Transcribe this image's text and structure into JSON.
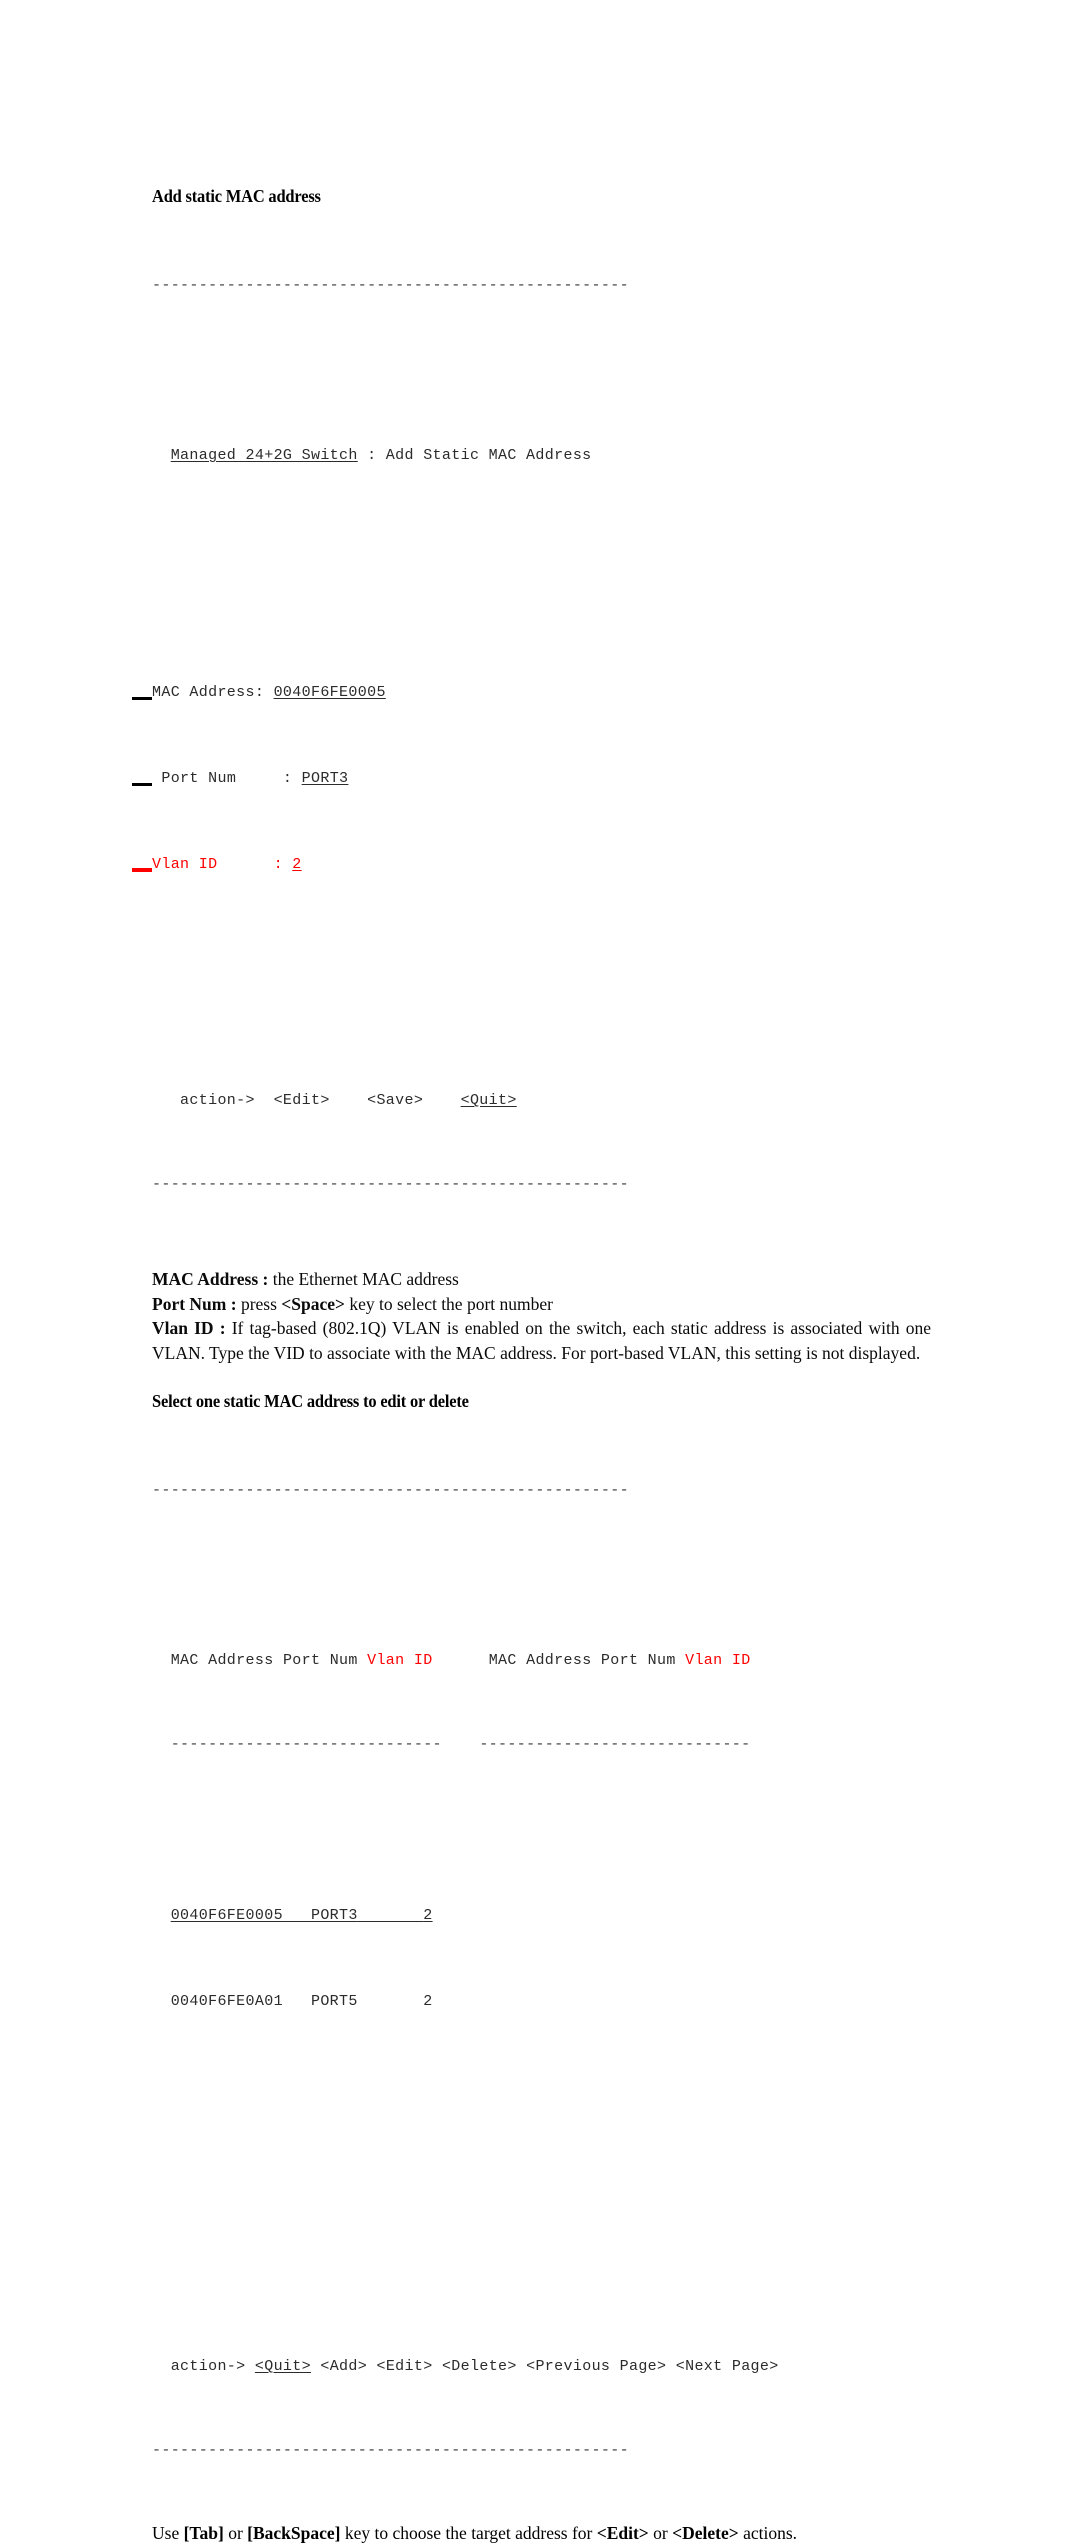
{
  "document": {
    "sections": [
      {
        "heading": "Add static MAC address",
        "terminal": {
          "top_rule": "---------------------------------------------------",
          "bottom_rule": "---------------------------------------------------",
          "title_prefix": "  ",
          "title_highlight": "Managed 24+2G Switch",
          "title_rest": " : Add Static MAC Address",
          "fields": [
            {
              "label": "MAC Address:",
              "pad": " ",
              "value": "0040F6FE0005",
              "marker": "black",
              "indent": ""
            },
            {
              "label": "Port Num",
              "pad": "     : ",
              "value": "PORT3",
              "marker": "black",
              "indent": " "
            },
            {
              "label": "Vlan ID",
              "pad": "      : ",
              "value": "2",
              "marker": "red",
              "indent": ""
            }
          ],
          "action_prefix": "   action->  ",
          "actions": [
            {
              "label": "<Edit>",
              "selected": false
            },
            {
              "label": "<Save>",
              "selected": false
            },
            {
              "label": "<Quit>",
              "selected": true
            }
          ],
          "action_gap": "  "
        }
      }
    ],
    "descriptions": [
      {
        "term": "MAC Address :",
        "text": " the Ethernet MAC address"
      },
      {
        "term": "Port Num :",
        "text": " press ",
        "kbd": "<Space>",
        "text2": " key to select the port number"
      },
      {
        "term": "Vlan ID :",
        "text": " If tag-based (802.1Q) VLAN is enabled on the switch, each static address is associated with one VLAN. Type the VID to associate with the MAC address. For port-based VLAN, this setting is not displayed."
      }
    ],
    "section2": {
      "heading": "Select one static MAC address to edit or delete",
      "terminal": {
        "top_rule": "---------------------------------------------------",
        "bottom_rule": "---------------------------------------------------",
        "header_indent": "  ",
        "columns": [
          "MAC Address",
          "Port Num",
          "Vlan ID"
        ],
        "column_gap": "      ",
        "col_rule": "-----------------------------",
        "col_rule_gap": "    ",
        "rows": [
          {
            "mac": "0040F6FE0005",
            "port": "PORT3",
            "vlan": "2",
            "selected": true
          },
          {
            "mac": "0040F6FE0A01",
            "port": "PORT5",
            "vlan": "2",
            "selected": false
          }
        ],
        "action_prefix": "  action-> ",
        "actions": [
          {
            "label": "<Quit>",
            "selected": true
          },
          {
            "label": "<Add>",
            "selected": false
          },
          {
            "label": "<Edit>",
            "selected": false
          },
          {
            "label": "<Delete>",
            "selected": false
          },
          {
            "label": "<Previous Page>",
            "selected": false
          },
          {
            "label": "<Next Page>",
            "selected": false
          }
        ],
        "action_gap": " "
      }
    },
    "footnote": {
      "p1": "Use ",
      "k1": "[Tab]",
      "p2": " or ",
      "k2": "[BackSpace]",
      "p3": " key to choose the target address for ",
      "k3": "<Edit>",
      "p4": " or ",
      "k4": "<Delete>",
      "p5": " actions."
    },
    "colors": {
      "accent_red": "#FE0000",
      "terminal_text": "#2B2B2B",
      "body_text": "#000000"
    }
  }
}
